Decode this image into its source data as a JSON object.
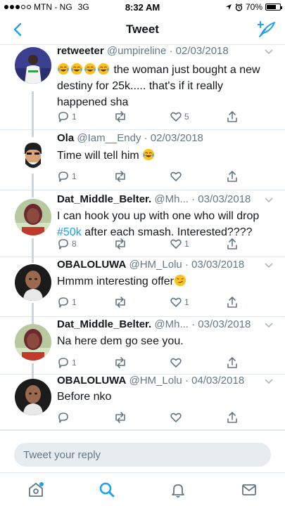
{
  "status_bar": {
    "carrier": "MTN - NG",
    "network": "3G",
    "time": "8:32 AM",
    "battery": "70%",
    "battery_level": 0.7
  },
  "nav": {
    "title": "Tweet"
  },
  "tweets": [
    {
      "name": "retweeter",
      "handle": "@umpireline",
      "date": "· 02/03/2018",
      "emoji_count": 4,
      "text_html": "the woman just bought a new destiny for 25k..... that's if it really happened sha",
      "reply_count": "1",
      "retweet_count": "",
      "like_count": "5"
    },
    {
      "name": "Ola",
      "handle": "@Iam__Endy",
      "date": "· 02/03/2018",
      "text": "Time will tell him",
      "reply_count": "1",
      "retweet_count": "",
      "like_count": ""
    },
    {
      "name": "Dat_Middle_Belter.",
      "handle": "@Mh...",
      "date": "· 03/03/2018",
      "text_a": "I can hook you up with one who will drop",
      "hashtag": "#50k",
      "text_b": "after each smash. Interested????",
      "reply_count": "8",
      "retweet_count": "",
      "like_count": "1"
    },
    {
      "name": "OBALOLUWA",
      "handle": "@HM_Lolu",
      "date": "· 03/03/2018",
      "text": "Hmmm interesting offer",
      "reply_count": "1",
      "retweet_count": "",
      "like_count": "1"
    },
    {
      "name": "Dat_Middle_Belter.",
      "handle": "@Mh...",
      "date": "· 03/03/2018",
      "text": "Na here dem go see you.",
      "reply_count": "1",
      "retweet_count": "",
      "like_count": ""
    },
    {
      "name": "OBALOLUWA",
      "handle": "@HM_Lolu",
      "date": "· 04/03/2018",
      "text": "Before nko",
      "reply_count": "",
      "retweet_count": "",
      "like_count": ""
    }
  ],
  "reply": {
    "placeholder": "Tweet your reply"
  },
  "tabs": [
    "home-icon",
    "search-icon",
    "notifications-icon",
    "messages-icon"
  ],
  "colors": {
    "accent": "#1da1f2",
    "text": "#14171a",
    "secondary": "#657786",
    "border": "#e1e8ed",
    "input_bg": "#e6ecf0"
  }
}
